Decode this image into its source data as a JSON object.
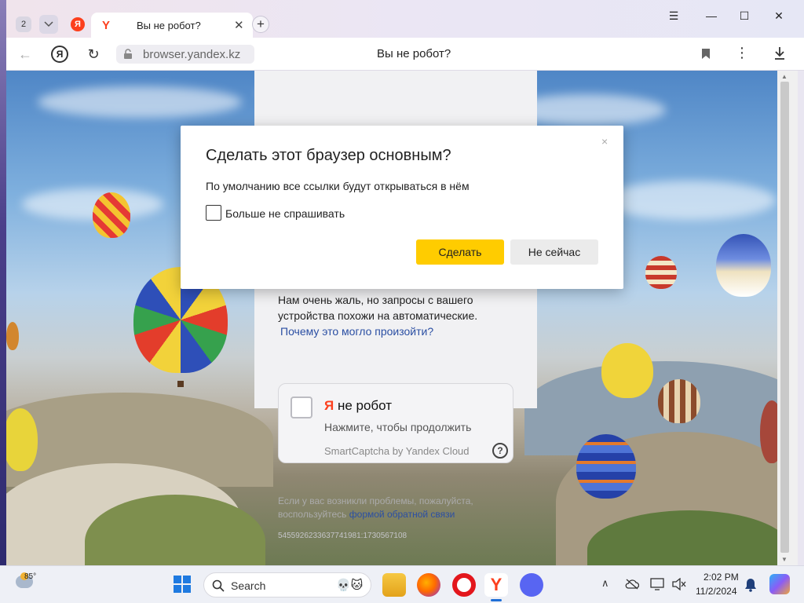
{
  "browser": {
    "tab_count": "2",
    "active_tab": {
      "favicon": "Y",
      "title": "Вы не робот?"
    },
    "pinned_tab_favicon": "Я",
    "new_tab_symbol": "+",
    "controls": {
      "menu": "☰",
      "minimize": "—",
      "maximize": "☐",
      "close": "✕"
    },
    "address": {
      "back": "←",
      "home_logo": "Я",
      "refresh": "↻",
      "url": "browser.yandex.kz",
      "page_title": "Вы не робот?",
      "menu": "⋮"
    }
  },
  "dialog": {
    "close_symbol": "×",
    "title": "Сделать этот браузер основным?",
    "description": "По умолчанию все ссылки будут открываться в нём",
    "checkbox_label": "Больше не спрашивать",
    "primary_button": "Сделать",
    "secondary_button": "Не сейчас"
  },
  "captcha": {
    "message": "Нам очень жаль, но запросы с вашего устройства похожи на автоматические.",
    "why_link": "Почему это могло произойти?",
    "box_title_ya": "Я",
    "box_title_rest": " не робот",
    "box_subtitle": "Нажмите, чтобы продолжить",
    "brand": "SmartCaptcha by Yandex Cloud",
    "help_symbol": "?",
    "footer_text": "Если у вас возникли проблемы, пожалуйста, воспользуйтесь ",
    "footer_link": "формой обратной связи",
    "request_id": "5455926233637741981:1730567108"
  },
  "taskbar": {
    "weather_temp": "85°",
    "search_label": "Search",
    "clock_time": "2:02 PM",
    "clock_date": "11/2/2024",
    "tray_chevron": "∧"
  },
  "colors": {
    "yandex_red": "#fc3f1d",
    "primary_yellow": "#ffcc00",
    "link_blue": "#2b4fa3"
  }
}
